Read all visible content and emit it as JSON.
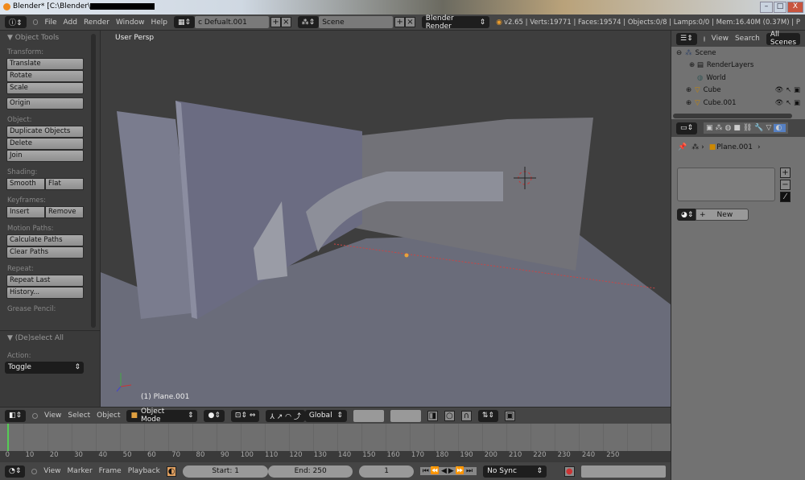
{
  "window": {
    "title": "Blender* [C:\\Blender\\",
    "min": "–",
    "max": "□",
    "close": "X"
  },
  "info_header": {
    "menus": [
      "File",
      "Add",
      "Render",
      "Window",
      "Help"
    ],
    "screen": "c Defualt.001",
    "scene": "Scene",
    "engine": "Blender Render",
    "stats": "v2.65 | Verts:19771 | Faces:19574 | Objects:0/8 | Lamps:0/0 | Mem:16.40M (0.37M) | P"
  },
  "tools": {
    "title": "Object Tools",
    "sections": {
      "transform": "Transform:",
      "object": "Object:",
      "shading": "Shading:",
      "keyframes": "Keyframes:",
      "motion": "Motion Paths:",
      "repeat": "Repeat:",
      "grease": "Grease Pencil:"
    },
    "buttons": {
      "translate": "Translate",
      "rotate": "Rotate",
      "scale": "Scale",
      "origin": "Origin",
      "duplicate": "Duplicate Objects",
      "delete": "Delete",
      "join": "Join",
      "smooth": "Smooth",
      "flat": "Flat",
      "insert": "Insert",
      "remove": "Remove",
      "calc_paths": "Calculate Paths",
      "clear_paths": "Clear Paths",
      "repeat_last": "Repeat Last",
      "history": "History..."
    },
    "op_title": "(De)select All",
    "action_label": "Action:",
    "action_value": "Toggle"
  },
  "viewport": {
    "view_label": "User Persp",
    "object_label": "(1) Plane.001"
  },
  "view3d_header": {
    "menus": [
      "View",
      "Select",
      "Object"
    ],
    "mode": "Object Mode",
    "orientation": "Global"
  },
  "timeline": {
    "ticks": [
      "0",
      "10",
      "20",
      "30",
      "40",
      "50",
      "60",
      "70",
      "80",
      "90",
      "100",
      "110",
      "120",
      "130",
      "140",
      "150",
      "160",
      "170",
      "180",
      "190",
      "200",
      "210",
      "220",
      "230",
      "240",
      "250"
    ],
    "current_frame_fraction": 0.0
  },
  "timeline_header": {
    "menus": [
      "View",
      "Marker",
      "Frame",
      "Playback"
    ],
    "start": "Start: 1",
    "end": "End: 250",
    "current": "1",
    "sync": "No Sync"
  },
  "outliner": {
    "menus": [
      "View",
      "Search"
    ],
    "filter": "All Scenes",
    "items": [
      {
        "label": "Scene"
      },
      {
        "label": "RenderLayers"
      },
      {
        "label": "World"
      },
      {
        "label": "Cube"
      },
      {
        "label": "Cube.001"
      }
    ]
  },
  "properties": {
    "breadcrumb": "Plane.001",
    "new_label": "New",
    "add": "+",
    "remove": "−"
  }
}
